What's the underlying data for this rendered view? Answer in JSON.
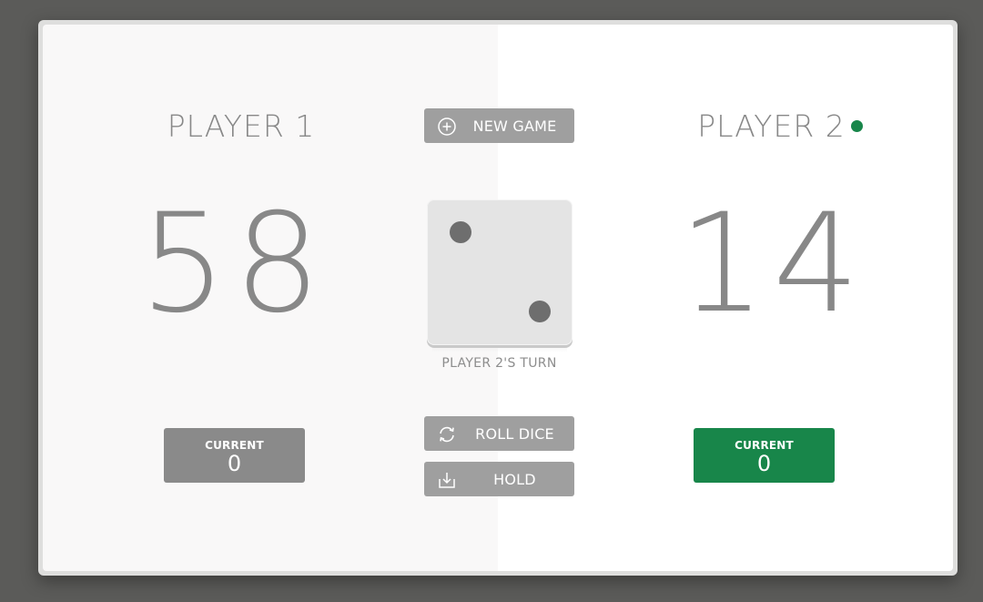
{
  "players": [
    {
      "name": "PLAYER 1",
      "score": "58",
      "current_label": "CURRENT",
      "current": "0",
      "active": false
    },
    {
      "name": "PLAYER 2",
      "score": "14",
      "current_label": "CURRENT",
      "current": "0",
      "active": true
    }
  ],
  "buttons": {
    "new_game": "NEW GAME",
    "roll_dice": "ROLL DICE",
    "hold": "HOLD"
  },
  "dice": {
    "value": 2
  },
  "turn_text": "PLAYER 2'S TURN",
  "icons": {
    "new_game": "plus-circle-icon",
    "roll_dice": "refresh-icon",
    "hold": "download-icon",
    "active_player": "active-dot-icon"
  },
  "colors": {
    "active": "#18864a",
    "inactive_box": "#8a8a8a",
    "button": "#9f9f9f"
  }
}
